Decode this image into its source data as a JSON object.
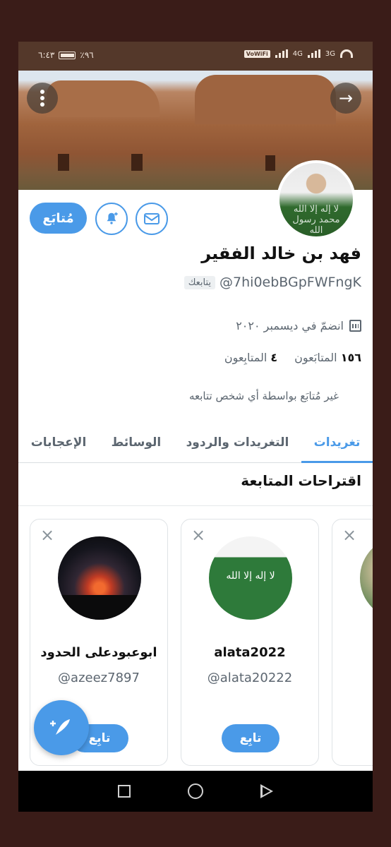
{
  "status_bar": {
    "time": "٦:٤٣",
    "battery": "٪٩٦",
    "network_3g": "3G",
    "network_4g": "4G",
    "volte": "VoWiFi"
  },
  "banner": {
    "menu_icon": "more-vertical-icon",
    "forward_icon": "arrow-right-icon"
  },
  "avatar": {
    "flag_text": "لا إله إلا الله محمد رسول الله"
  },
  "actions": {
    "mail_icon": "mail-icon",
    "bell_icon": "bell-plus-icon",
    "follow_label": "مُتابَع"
  },
  "profile": {
    "name": "فهد بن خالد الفقير",
    "handle": "@7hi0ebBGpFWFngK",
    "follows_you": "يتابعك",
    "joined": "انضمّ في ديسمبر ٢٠٢٠",
    "followers_count": "١٥٦",
    "followers_label": "المتابَعون",
    "following_count": "٤",
    "following_label": "المتابِعون",
    "not_followed": "غير مُتابَع بواسطة أي شخص تتابعه"
  },
  "tabs": [
    {
      "label": "تغريدات",
      "active": true
    },
    {
      "label": "التغريدات والردود",
      "active": false
    },
    {
      "label": "الوسائط",
      "active": false
    },
    {
      "label": "الإعجابات",
      "active": false
    }
  ],
  "suggestions": {
    "title": "اقتراحات المتابعة",
    "cards": [
      {
        "name": "ابوعبودعلى الحدود",
        "handle": "@azeez7897",
        "follow_label": "تابِع"
      },
      {
        "name": "alata2022",
        "handle": "@alata20222",
        "follow_label": "تابِع"
      }
    ]
  },
  "compose": {
    "icon": "compose-feather-plus-icon"
  },
  "nav": {
    "back_icon": "back-triangle-icon",
    "home_icon": "home-circle-icon",
    "recent_icon": "recent-square-icon"
  },
  "colors": {
    "accent": "#4a9ae8",
    "status_bar": "#54382a",
    "frame_bg": "#3a1c18"
  }
}
